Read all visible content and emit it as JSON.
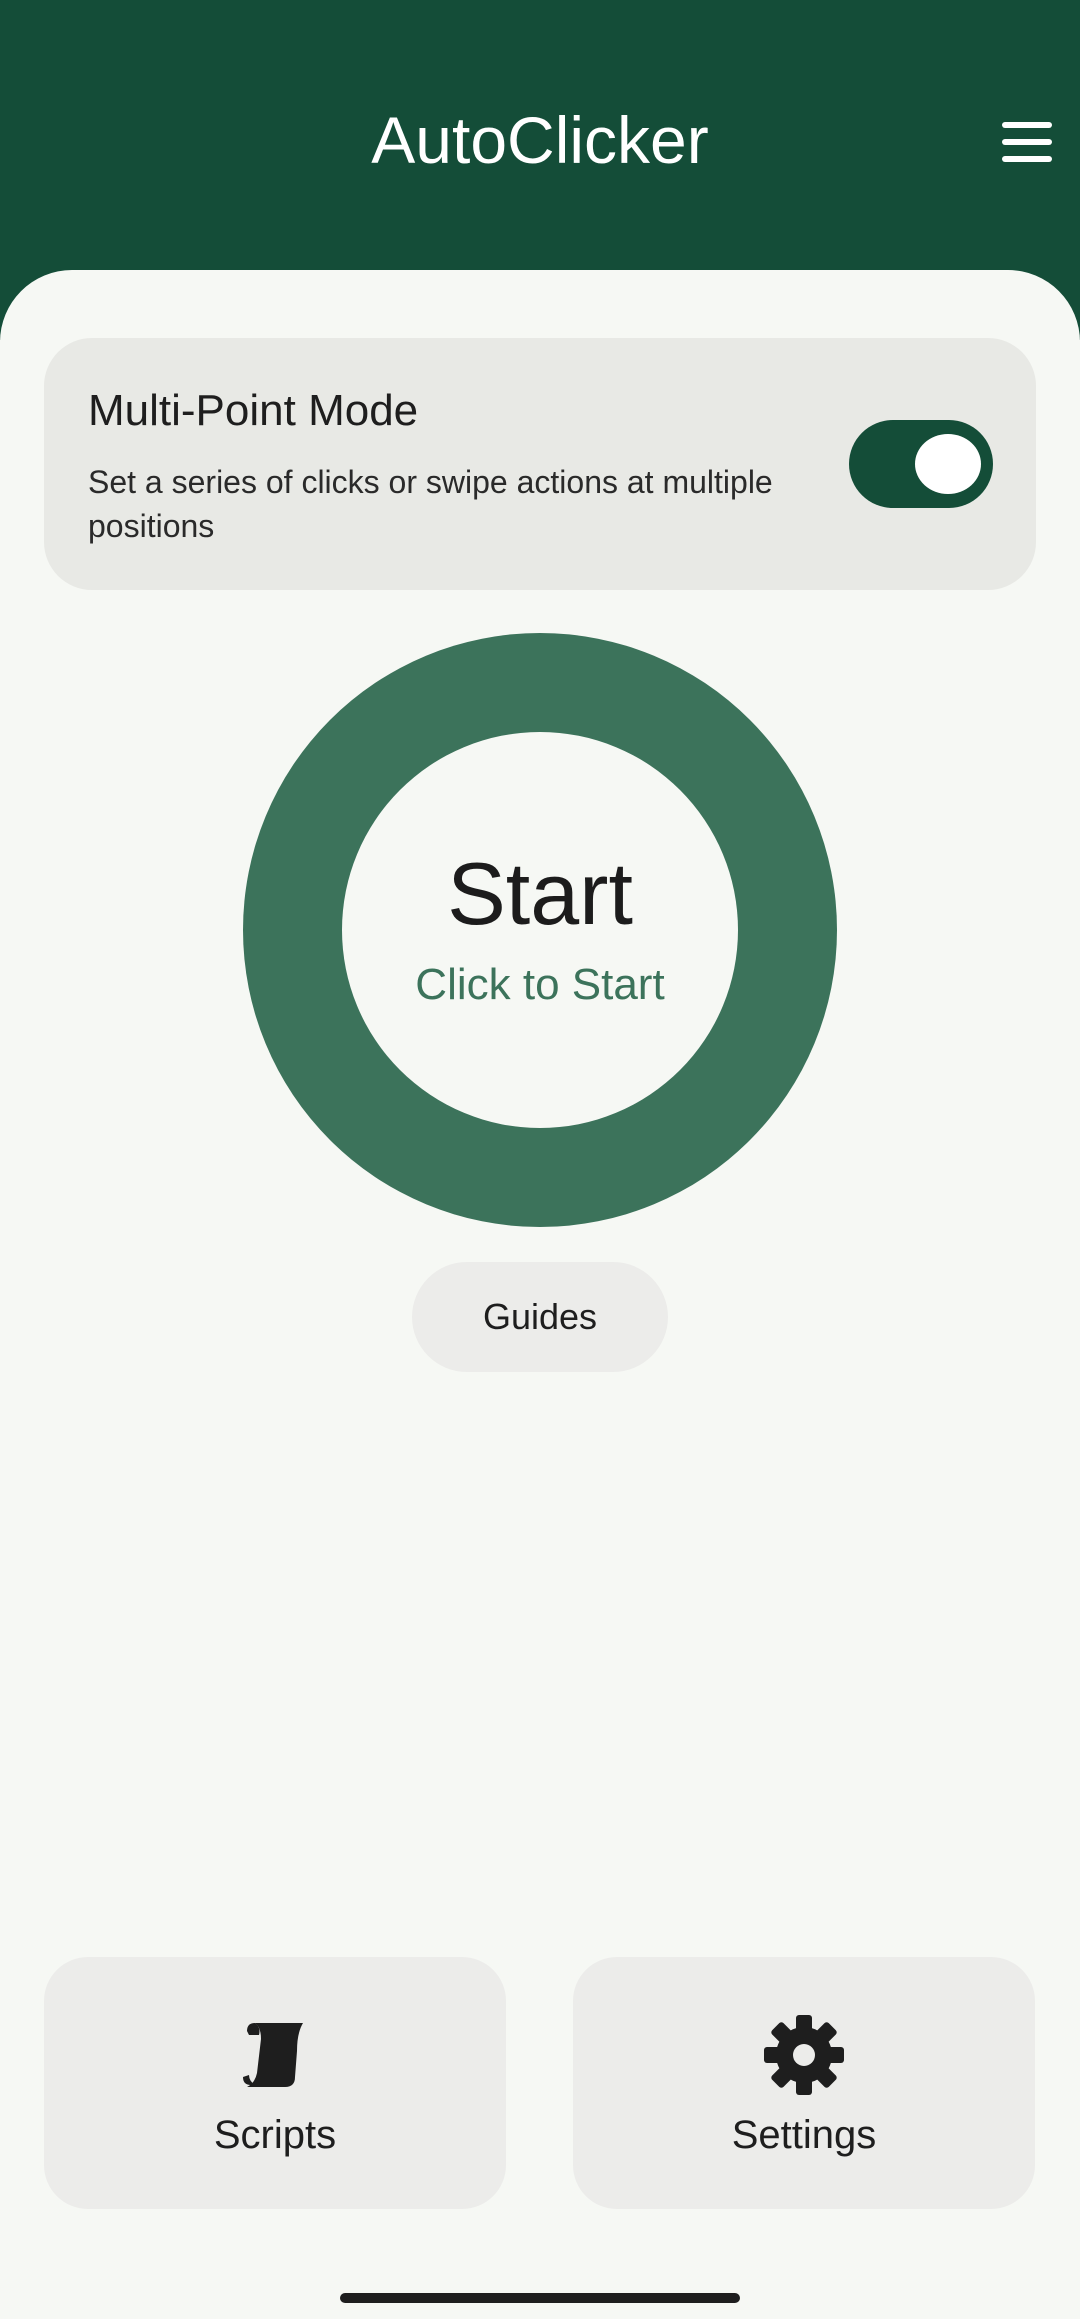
{
  "app": {
    "title": "AutoClicker",
    "menu_icon": "menu-icon"
  },
  "mode_card": {
    "title": "Multi-Point Mode",
    "description": "Set a series of clicks or swipe actions at multiple positions",
    "toggle_on": true
  },
  "start_button": {
    "label": "Start",
    "sublabel": "Click to Start"
  },
  "guides_button": {
    "label": "Guides"
  },
  "bottom_nav": {
    "scripts": {
      "label": "Scripts",
      "icon": "scroll-icon"
    },
    "settings": {
      "label": "Settings",
      "icon": "gear-icon"
    }
  },
  "colors": {
    "header_bg": "#144D38",
    "accent": "#3C735B",
    "background": "#F6F8F4",
    "card_bg": "#E8E9E5"
  }
}
